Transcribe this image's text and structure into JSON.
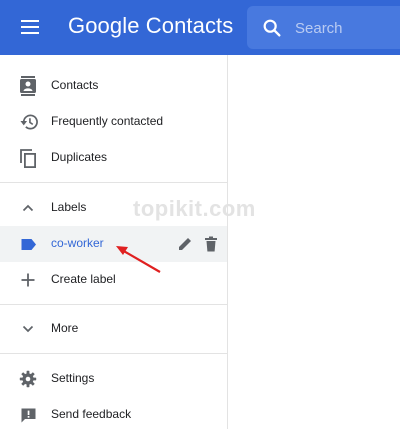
{
  "header": {
    "title": "Google Contacts",
    "search_placeholder": "Search",
    "menu_icon": "hamburger-menu-icon",
    "search_icon": "search-icon"
  },
  "sidebar": {
    "items": [
      {
        "label": "Contacts",
        "icon": "contacts-icon"
      },
      {
        "label": "Frequently contacted",
        "icon": "history-icon"
      },
      {
        "label": "Duplicates",
        "icon": "duplicate-icon"
      },
      {
        "label": "Labels",
        "icon": "chevron-up-icon"
      },
      {
        "label": "co-worker",
        "icon": "label-icon",
        "active": true
      },
      {
        "label": "Create label",
        "icon": "plus-icon"
      },
      {
        "label": "More",
        "icon": "chevron-down-icon"
      },
      {
        "label": "Settings",
        "icon": "gear-icon"
      },
      {
        "label": "Send feedback",
        "icon": "feedback-icon"
      }
    ]
  },
  "watermark": "topikit.com",
  "colors": {
    "header": "#3367d6",
    "search": "#4879df",
    "accent": "#3367d6",
    "arrow": "#e02020"
  }
}
